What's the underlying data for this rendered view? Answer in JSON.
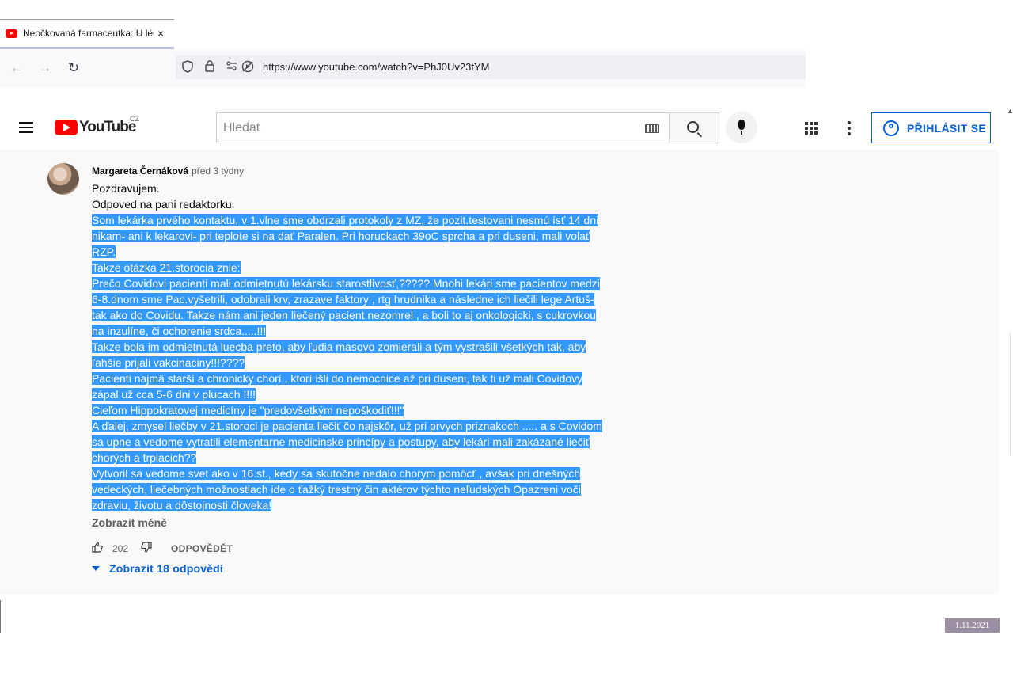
{
  "browser": {
    "tab_title": "Neočkovaná farmaceutka: U léč",
    "tab_close": "×",
    "url": "https://www.youtube.com/watch?v=PhJ0Uv23tYM",
    "back_icon": "←",
    "forward_icon": "→",
    "reload_icon": "↻"
  },
  "youtube": {
    "logo_text": "YouTube",
    "country": "CZ",
    "search_placeholder": "Hledat",
    "signin_label": "PŘIHLÁSIT SE",
    "brand_color": "#ff0000",
    "link_color": "#065fd4"
  },
  "comment": {
    "author": "Margareta Černáková",
    "time": "před 3 týdny",
    "lines_plain": [
      "Pozdravujem.",
      "Odpoved na pani redaktorku."
    ],
    "lines_selected": [
      "Som lekárka prvého kontaktu, v 1.vlne sme obdrzali protokoly z MZ, že pozit.testovani nesmú ísť 14 dni",
      "nikam- ani k lekarovi- pri teplote si na dať Paralen. Pri horuckach 39oC sprcha a pri duseni, mali volať",
      "RZP.",
      "Takze otázka 21.storocia znie:",
      "Prečo Covidovi pacienti mali odmietnutú  lekársku starostlivosť,????? Mnohi lekári sme pacientov medzi",
      "6-8.dnom sme Pac.vyšetrili, odobrali krv, zrazave faktory , rtg hrudnika a následne ich liečili lege Artuš-",
      "tak ako do Covidu. Takze nám ani jeden liečený pacient nezomrel , a boli to aj onkologicki, s cukrovkou",
      "na inzulíne, či ochorenie srdca.....!!!",
      "Takze bola im odmietnutá luecba preto, aby ľudia masovo zomierali a tým vystrašili všetkých tak, aby",
      "ľahšie prijali vakcinaciny!!!????",
      "Pacienti najmä starší a chronicky chorí , ktorí išli do nemocnice až pri duseni, tak ti už mali Covidovy",
      "zápal už cca 5-6 dni v plucach !!!!",
      "Cieľom Hippokratovej medicíny je \"predovšetkým nepoškodiť!!!\"",
      "A ďalej, zmysel liečby v 21.storoci je pacienta liečiť čo najskôr, už pri prvych priznakoch ..... a s Covidom",
      "sa upne a vedome vytratili elementarne medicinske princípy a postupy, aby lekári mali zakázané liečiť",
      "chorých a trpiacich?? ",
      "Vytvoril sa vedome svet ako v 16.st., kedy sa skutočne nedalo chorym pomôcť , avšak pri dnešných",
      "vedeckých, liečebných možnostiach ide o ťažký trestný čin aktérov týchto neľudských Opazreni voči",
      "zdraviu, životu a dôstojnosti človeka!"
    ],
    "show_less": "Zobrazit méně",
    "like_count": "202",
    "reply_label": "ODPOVĚDĚT",
    "replies_label": "Zobrazit 18 odpovědí",
    "selection_color": "#3399ff"
  },
  "date_stamp": "1.11.2021"
}
